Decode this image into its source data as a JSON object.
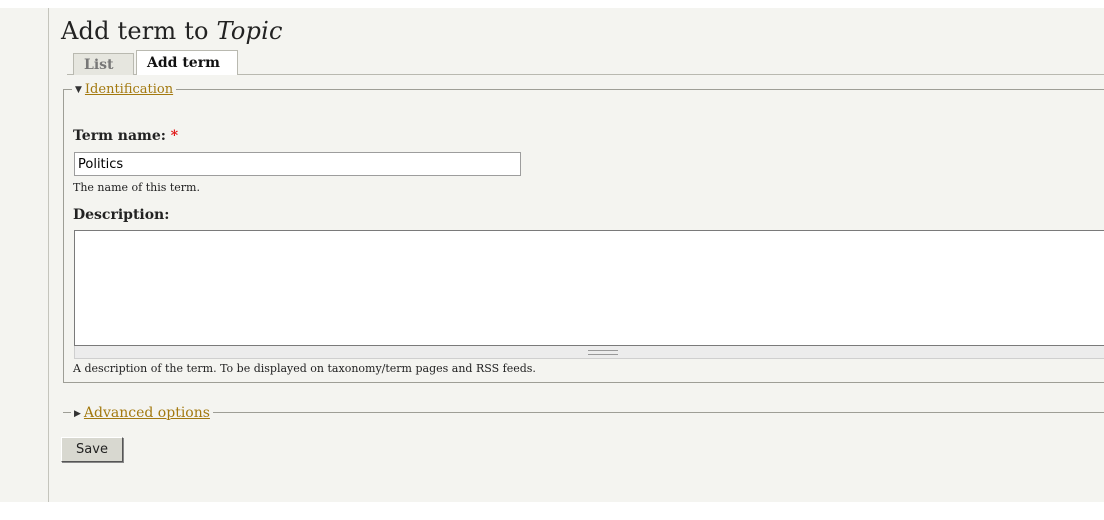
{
  "page": {
    "title_prefix": "Add term to",
    "title_vocab": "Topic"
  },
  "tabs": [
    {
      "label": "List",
      "active": false
    },
    {
      "label": "Add term",
      "active": true
    }
  ],
  "identification": {
    "legend": "Identification",
    "expanded": true,
    "term_name": {
      "label": "Term name:",
      "required_marker": "*",
      "value": "Politics",
      "help": "The name of this term."
    },
    "description": {
      "label": "Description:",
      "value": "",
      "help": "A description of the term. To be displayed on taxonomy/term pages and RSS feeds."
    }
  },
  "advanced": {
    "legend": "Advanced options",
    "expanded": false
  },
  "save_label": "Save",
  "icons": {
    "expanded_caret": "▼",
    "collapsed_caret": "▶"
  },
  "colors": {
    "link": "#a3790f",
    "required": "#e01010",
    "background": "#f4f4f0"
  }
}
